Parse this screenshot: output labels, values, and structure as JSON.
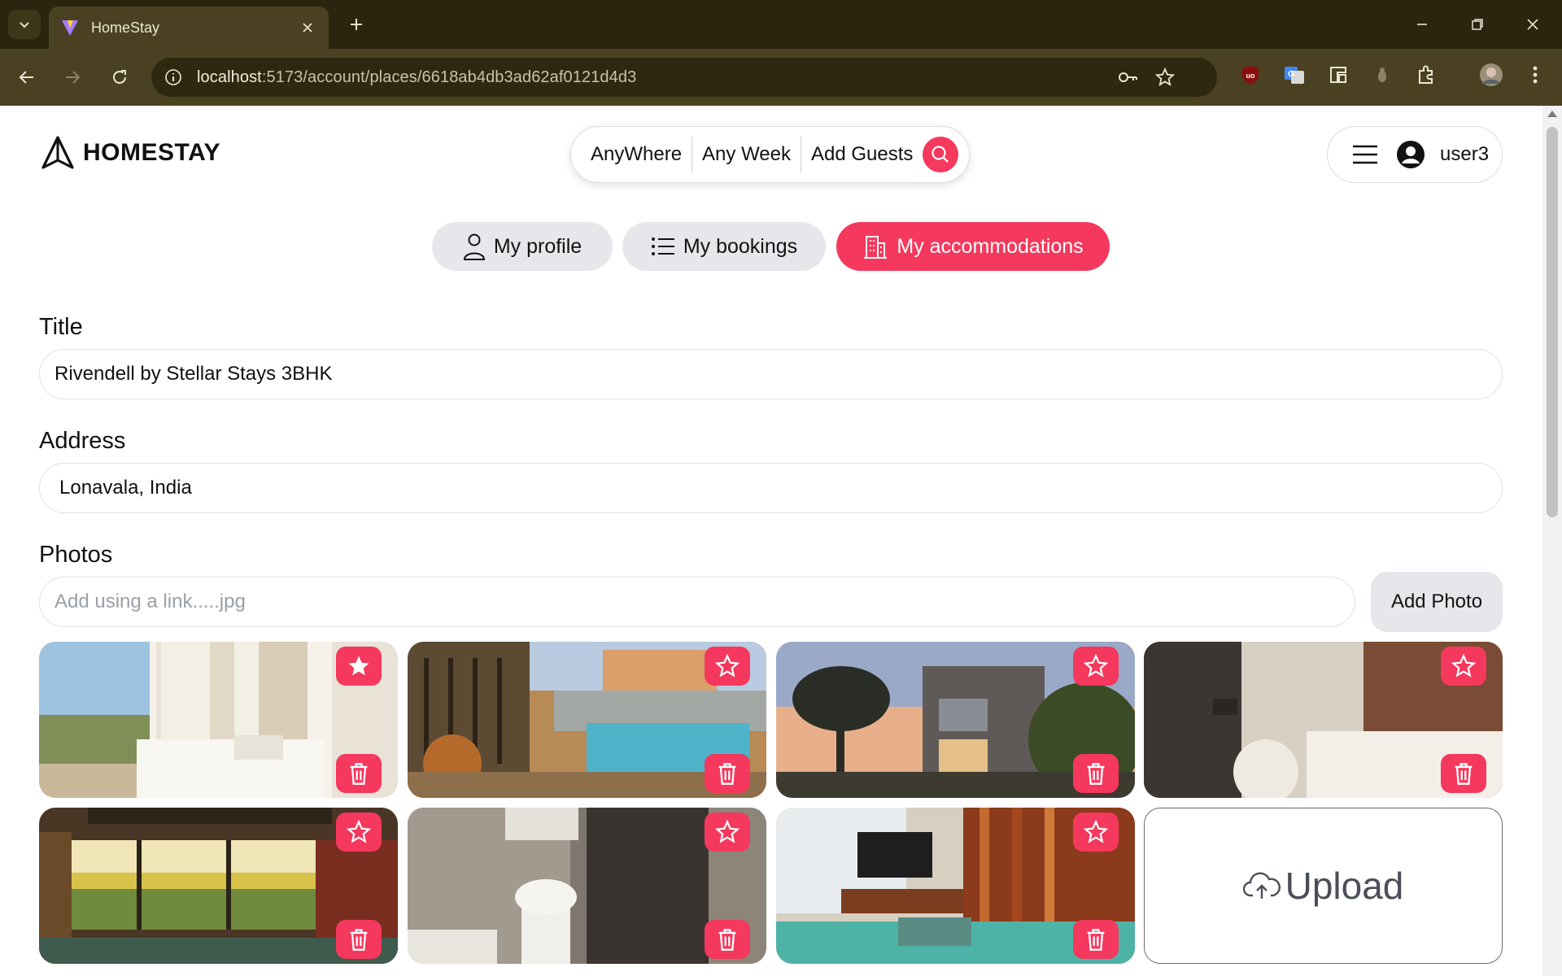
{
  "browser": {
    "tab_title": "HomeStay",
    "url_host": "localhost",
    "url_path": ":5173/account/places/6618ab4db3ad62af0121d4d3"
  },
  "header": {
    "logo_text": "HOMESTAY",
    "search": {
      "where": "AnyWhere",
      "week": "Any Week",
      "guests": "Add Guests"
    },
    "username": "user3"
  },
  "account_nav": {
    "profile": "My profile",
    "bookings": "My bookings",
    "accommodations": "My accommodations",
    "active": "accommodations"
  },
  "form": {
    "title_label": "Title",
    "title_value": "Rivendell by Stellar Stays 3BHK",
    "address_label": "Address",
    "address_value": "Lonavala, India",
    "photos_label": "Photos",
    "photo_link_placeholder": "Add using a link.....jpg",
    "add_photo_label": "Add Photo",
    "upload_label": "Upload"
  },
  "photos": [
    {
      "subject": "bedroom-with-view",
      "is_main": true
    },
    {
      "subject": "pool-deck",
      "is_main": false
    },
    {
      "subject": "villa-exterior-sunset",
      "is_main": false
    },
    {
      "subject": "bathroom-tub",
      "is_main": false
    },
    {
      "subject": "living-room-garden-view",
      "is_main": false
    },
    {
      "subject": "bathroom-shower",
      "is_main": false
    },
    {
      "subject": "lounge-tv-sofa",
      "is_main": false
    }
  ],
  "colors": {
    "accent": "#f5385d",
    "pill_grey": "#e5e7eb",
    "chrome_dark": "#2b2510",
    "chrome_toolbar": "#4a4122"
  }
}
